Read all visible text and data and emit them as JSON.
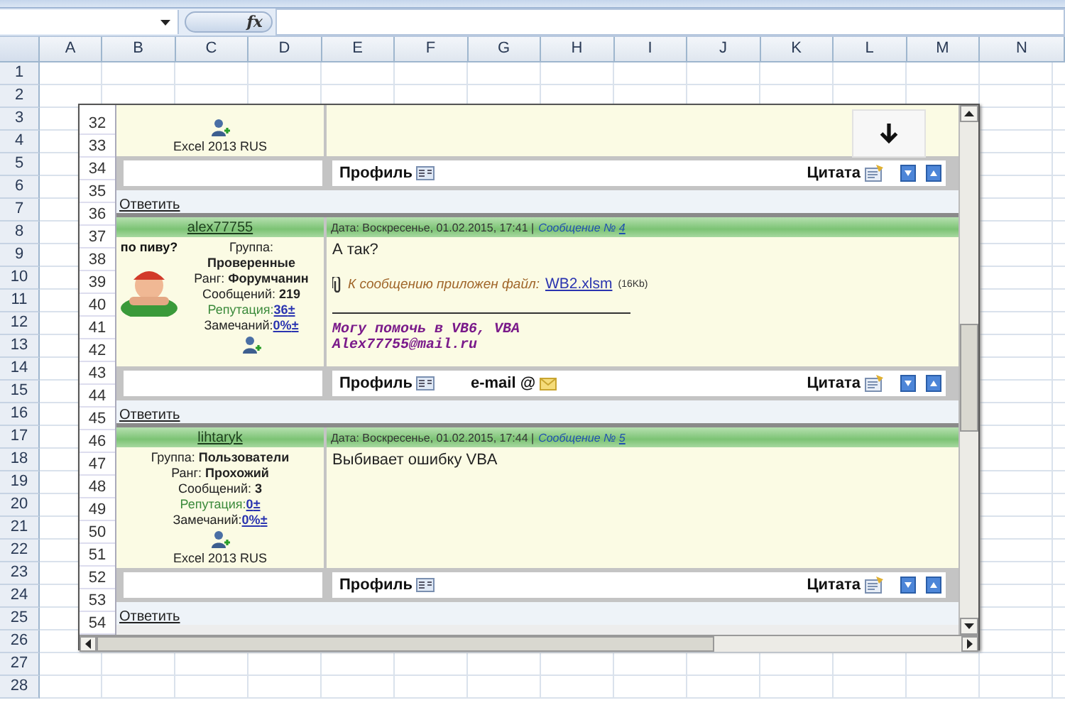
{
  "formula_bar": {
    "fx_label": "fx"
  },
  "columns": [
    "A",
    "B",
    "C",
    "D",
    "E",
    "F",
    "G",
    "H",
    "I",
    "J",
    "K",
    "L",
    "M",
    "N"
  ],
  "rows": [
    "1",
    "2",
    "3",
    "4",
    "5",
    "6",
    "7",
    "8",
    "9",
    "10",
    "11",
    "12",
    "13",
    "14",
    "15",
    "16",
    "17",
    "18",
    "19",
    "20",
    "21",
    "22",
    "23",
    "24",
    "25",
    "26",
    "27",
    "28"
  ],
  "embedded_picture": {
    "row_numbers": [
      "32",
      "33",
      "34",
      "35",
      "36",
      "37",
      "38",
      "39",
      "40",
      "41",
      "42",
      "43",
      "44",
      "45",
      "46",
      "47",
      "48",
      "49",
      "50",
      "51",
      "52",
      "53",
      "54"
    ],
    "sections": [
      {
        "kind": "post_tail",
        "os": "Excel 2013 RUS"
      },
      {
        "kind": "footer",
        "profile": "Профиль",
        "quote": "Цитата"
      },
      {
        "kind": "reply",
        "label": "Ответить"
      },
      {
        "kind": "post",
        "user": "alex77755",
        "date": "Дата: Воскресенье, 01.02.2015, 17:41 |",
        "message_label": "Сообщение №",
        "message_number": "4",
        "status": "по пиву?",
        "has_avatar": true,
        "info": [
          {
            "kind": "stacked",
            "label": "Группа:",
            "value": "Проверенные"
          },
          {
            "kind": "inline",
            "label": "Ранг:",
            "value": "Форумчанин"
          },
          {
            "kind": "inline",
            "label": "Сообщений:",
            "value": "219"
          },
          {
            "kind": "reputation",
            "label": "Репутация:",
            "value": "36",
            "sign": "±"
          },
          {
            "kind": "warnings",
            "label": "Замечаний:",
            "value": "0%",
            "sign": "±"
          }
        ],
        "body": "А так?",
        "attachment": {
          "label": "К сообщению приложен файл:",
          "file": "WB2.xlsm",
          "size": "(16Kb)"
        },
        "signature": [
          "Могу помочь в VB6, VBA",
          "Alex77755@mail.ru"
        ]
      },
      {
        "kind": "footer",
        "profile": "Профиль",
        "email": "e-mail @",
        "quote": "Цитата"
      },
      {
        "kind": "reply",
        "label": "Ответить"
      },
      {
        "kind": "post",
        "user": "lihtaryk",
        "date": "Дата: Воскресенье, 01.02.2015, 17:44 |",
        "message_label": "Сообщение №",
        "message_number": "5",
        "has_avatar": false,
        "info": [
          {
            "kind": "inline",
            "label": "Группа:",
            "value": "Пользователи"
          },
          {
            "kind": "inline",
            "label": "Ранг:",
            "value": "Прохожий"
          },
          {
            "kind": "inline",
            "label": "Сообщений:",
            "value": "3"
          },
          {
            "kind": "reputation",
            "label": "Репутация:",
            "value": "0",
            "sign": "±"
          },
          {
            "kind": "warnings",
            "label": "Замечаний:",
            "value": "0%",
            "sign": "±"
          }
        ],
        "os": "Excel 2013 RUS",
        "body": "Выбивает ошибку VBA"
      },
      {
        "kind": "footer",
        "profile": "Профиль",
        "quote": "Цитата"
      },
      {
        "kind": "reply",
        "label": "Ответить"
      }
    ]
  }
}
